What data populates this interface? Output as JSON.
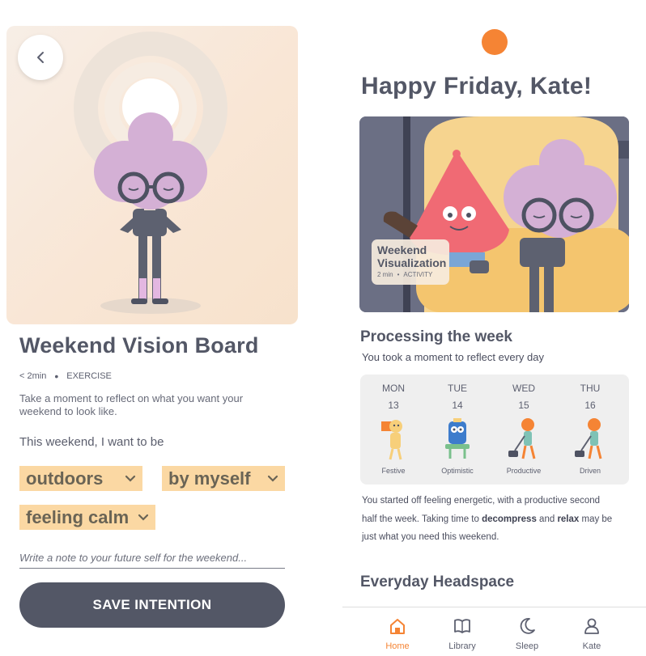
{
  "lesson": {
    "title": "Weekend Vision Board",
    "duration": "< 2min",
    "separator": "•",
    "type": "EXERCISE",
    "description": "Take a moment to reflect on what you want your weekend to look like.",
    "prompt": "This weekend, I want to be",
    "chips": [
      {
        "label": "outdoors"
      },
      {
        "label": "by myself"
      },
      {
        "label": "feeling calm"
      }
    ],
    "note_placeholder": "Write a note to your future self for the weekend...",
    "save_label": "SAVE INTENTION"
  },
  "home": {
    "greeting": "Happy Friday, Kate!",
    "feature": {
      "title": "Weekend Visualization",
      "duration": "2 min",
      "separator": "•",
      "type": "ACTIVITY"
    },
    "processing": {
      "title": "Processing the week",
      "subtitle": "You took a moment to reflect every day",
      "days": [
        {
          "name": "MON",
          "date": "13",
          "mood": "Festive"
        },
        {
          "name": "TUE",
          "date": "14",
          "mood": "Optimistic"
        },
        {
          "name": "WED",
          "date": "15",
          "mood": "Productive"
        },
        {
          "name": "THU",
          "date": "16",
          "mood": "Driven"
        }
      ],
      "summary_1": "You started off feeling energetic, with a  productive second half the week. Taking time to ",
      "summary_bold_1": "decompress",
      "summary_2": " and ",
      "summary_bold_2": "relax",
      "summary_3": " may be just what you need this weekend."
    },
    "everyday_title": "Everyday Headspace",
    "tabs": [
      {
        "label": "Home",
        "icon": "home-icon"
      },
      {
        "label": "Library",
        "icon": "book-icon"
      },
      {
        "label": "Sleep",
        "icon": "moon-icon"
      },
      {
        "label": "Kate",
        "icon": "person-icon"
      }
    ]
  },
  "colors": {
    "accent": "#f58434",
    "chip": "#fbd8a3",
    "button": "#535766",
    "text": "#535766"
  }
}
